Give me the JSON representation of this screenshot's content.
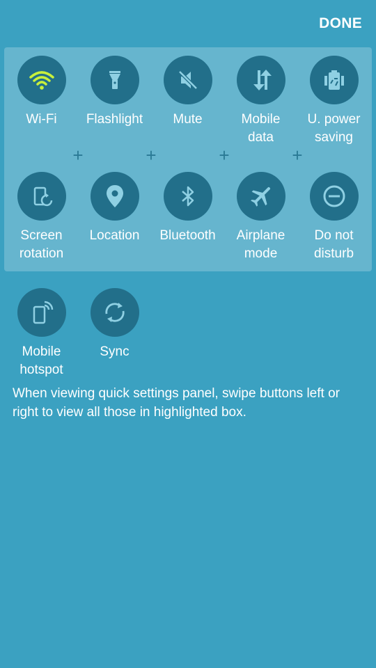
{
  "header": {
    "done_label": "DONE"
  },
  "active_color": "#c8f03c",
  "panel_tiles": [
    {
      "label": "Wi-Fi",
      "icon": "wifi-icon",
      "active": true
    },
    {
      "label": "Flashlight",
      "icon": "flashlight-icon",
      "active": false
    },
    {
      "label": "Mute",
      "icon": "mute-icon",
      "active": false
    },
    {
      "label": "Mobile\ndata",
      "icon": "mobile-data-icon",
      "active": false
    },
    {
      "label": "U. power\nsaving",
      "icon": "power-saving-icon",
      "active": false
    },
    {
      "label": "Screen\nrotation",
      "icon": "screen-rotation-icon",
      "active": false
    },
    {
      "label": "Location",
      "icon": "location-icon",
      "active": false
    },
    {
      "label": "Bluetooth",
      "icon": "bluetooth-icon",
      "active": false
    },
    {
      "label": "Airplane\nmode",
      "icon": "airplane-icon",
      "active": false
    },
    {
      "label": "Do not\ndisturb",
      "icon": "do-not-disturb-icon",
      "active": false
    }
  ],
  "extra_tiles": [
    {
      "label": "Mobile\nhotspot",
      "icon": "mobile-hotspot-icon",
      "active": false
    },
    {
      "label": "Sync",
      "icon": "sync-icon",
      "active": false
    }
  ],
  "hint_text": "When viewing quick settings panel, swipe buttons left or right to view all those in highlighted box."
}
